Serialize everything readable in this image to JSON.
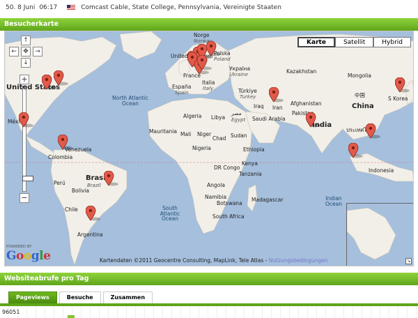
{
  "visit": {
    "date": "50.  8 Juni",
    "time": "06:17",
    "flag_icon": "us-flag-icon",
    "location": "Comcast Cable, State College, Pennsylvania, Vereinigte Staaten"
  },
  "sections": {
    "map_title": "Besucherkarte",
    "chart_title": "Websiteabrufe pro Tag"
  },
  "map": {
    "types": [
      {
        "label": "Karte",
        "active": true
      },
      {
        "label": "Satellit",
        "active": false
      },
      {
        "label": "Hybrid",
        "active": false
      }
    ],
    "controls": {
      "pan_up": "↑",
      "pan_down": "↓",
      "pan_left": "←",
      "pan_right": "→",
      "pan_center": "✥",
      "zoom_in": "+",
      "zoom_out": "−"
    },
    "labels": {
      "norway": "Norge",
      "norway_sub": "Norway",
      "uk": "United Kingdom",
      "poland": "Polska",
      "poland_sub": "Poland",
      "ukraine": "Україна",
      "ukraine_sub": "Ukraine",
      "france": "France",
      "spain": "España",
      "spain_sub": "Spain",
      "italy": "Italia",
      "italy_sub": "Italy",
      "kazakhstan": "Kazakhstan",
      "mongolia": "Mongolia",
      "china_cn": "中国",
      "china": "China",
      "turkey": "Türkiye",
      "turkey_sub": "Turkey",
      "iraq": "Iraq",
      "iran": "Iran",
      "afghanistan": "Afghanistan",
      "pakistan": "Pakistan",
      "india": "India",
      "saudi": "Saudi Arabia",
      "korea": "S Korea",
      "thailand": "ประเทศไทย",
      "indonesia": "Indonesia",
      "algeria": "Algeria",
      "libya": "Libya",
      "egypt": "مصر",
      "egypt_sub": "Egypt",
      "mauritania": "Mauritania",
      "mali": "Mali",
      "niger": "Niger",
      "chad": "Chad",
      "sudan": "Sudan",
      "nigeria": "Nigeria",
      "ethiopia": "Ethiopia",
      "kenya": "Kenya",
      "drcongo": "DR Congo",
      "tanzania": "Tanzania",
      "angola": "Angola",
      "namibia": "Namibia",
      "botswana": "Botswana",
      "madagascar": "Madagascar",
      "south_africa": "South Africa",
      "us": "United States",
      "mexico": "México",
      "venezuela": "Venezuela",
      "colombia": "Colombia",
      "peru": "Perú",
      "brazil": "Brasil",
      "brazil_sub": "Brazil",
      "bolivia": "Bolivia",
      "chile": "Chile",
      "argentina": "Argentina",
      "north_atlantic": "North Atlantic Ocean",
      "south_atlantic": "South Atlantic Ocean",
      "indian_ocean": "Indian Ocean"
    },
    "logo": {
      "powered": "POWERED BY",
      "word": "Google"
    },
    "copyright": "Kartendaten ©2011 Geocentre Consulting, MapLink, Tele Atlas - ",
    "terms_link": "Nutzungsbedingungen",
    "overview_toggle": "↘"
  },
  "chart": {
    "tabs": [
      {
        "label": "Pageviews",
        "active": true
      },
      {
        "label": "Besuche",
        "active": false
      },
      {
        "label": "Zusammen",
        "active": false
      }
    ],
    "y_max": "96051"
  }
}
